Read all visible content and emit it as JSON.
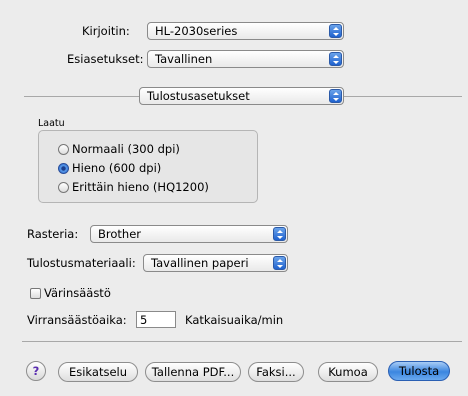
{
  "printer": {
    "label": "Kirjoitin:",
    "value": "HL-2030series"
  },
  "presets": {
    "label": "Esiasetukset:",
    "value": "Tavallinen"
  },
  "panel": {
    "value": "Tulostusasetukset"
  },
  "quality": {
    "title": "Laatu",
    "options": [
      {
        "label": "Normaali (300 dpi)",
        "selected": false
      },
      {
        "label": "Hieno (600 dpi)",
        "selected": true
      },
      {
        "label": "Erittäin hieno (HQ1200)",
        "selected": false
      }
    ]
  },
  "raster": {
    "label": "Rasteria:",
    "value": "Brother"
  },
  "media": {
    "label": "Tulostusmateriaali:",
    "value": "Tavallinen paperi"
  },
  "toner_save": {
    "label": "Värinsäästö",
    "checked": false
  },
  "sleep": {
    "label": "Virransäästöaika:",
    "value": "5",
    "unit": "Katkaisuaika/min"
  },
  "buttons": {
    "help": "?",
    "preview": "Esikatselu",
    "save_pdf": "Tallenna PDF...",
    "fax": "Faksi...",
    "cancel": "Kumoa",
    "print": "Tulosta"
  },
  "colors": {
    "accent": "#3b86e0",
    "background": "#ececec"
  }
}
